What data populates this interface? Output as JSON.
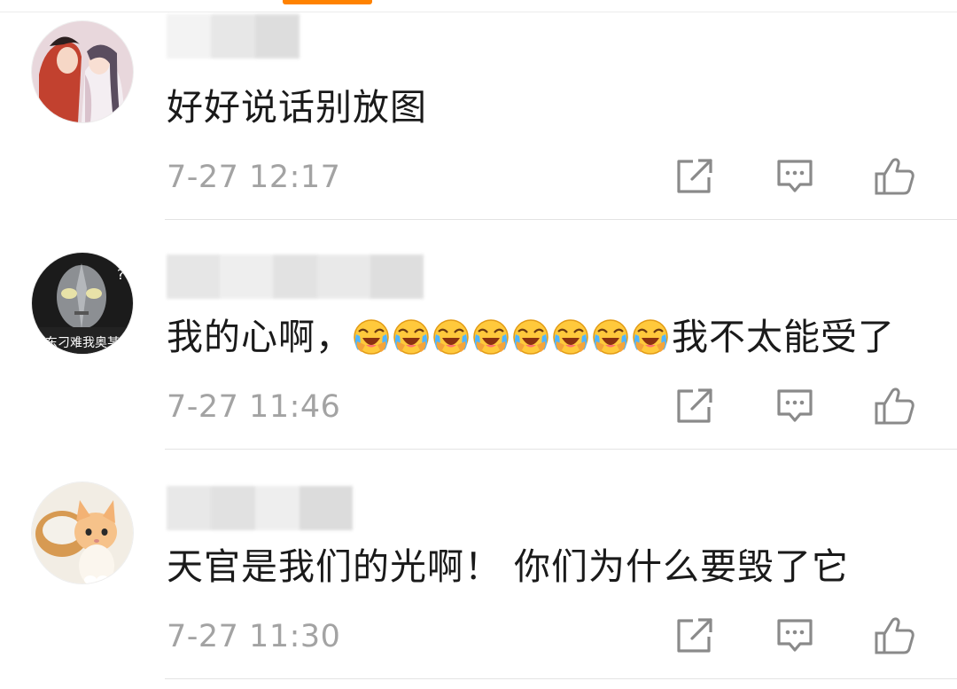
{
  "colors": {
    "accent": "#ff8200",
    "text": "#1a1a1a",
    "timestamp": "#a3a3a3",
    "icon": "#888888",
    "divider": "#e3e3e3"
  },
  "comments": [
    {
      "text": "好好说话别放图",
      "time": "7-27 12:17",
      "avatar": "anime-couple-avatar",
      "emoji_count": 0
    },
    {
      "text_before": "我的心啊，",
      "text_after": "我不太能受了",
      "time": "7-27 11:46",
      "avatar": "ultraman-avatar",
      "avatar_caption": "东刁难我奥某",
      "avatar_badge": "?",
      "emoji": "crying-laughing-emoji",
      "emoji_count": 8
    },
    {
      "text": "天官是我们的光啊！ 你们为什么要毁了它",
      "time": "7-27 11:30",
      "avatar": "kitten-avatar",
      "emoji_count": 0
    }
  ],
  "actions": {
    "repost_icon": "share-icon",
    "comment_icon": "comment-icon",
    "like_icon": "thumbs-up-icon"
  }
}
